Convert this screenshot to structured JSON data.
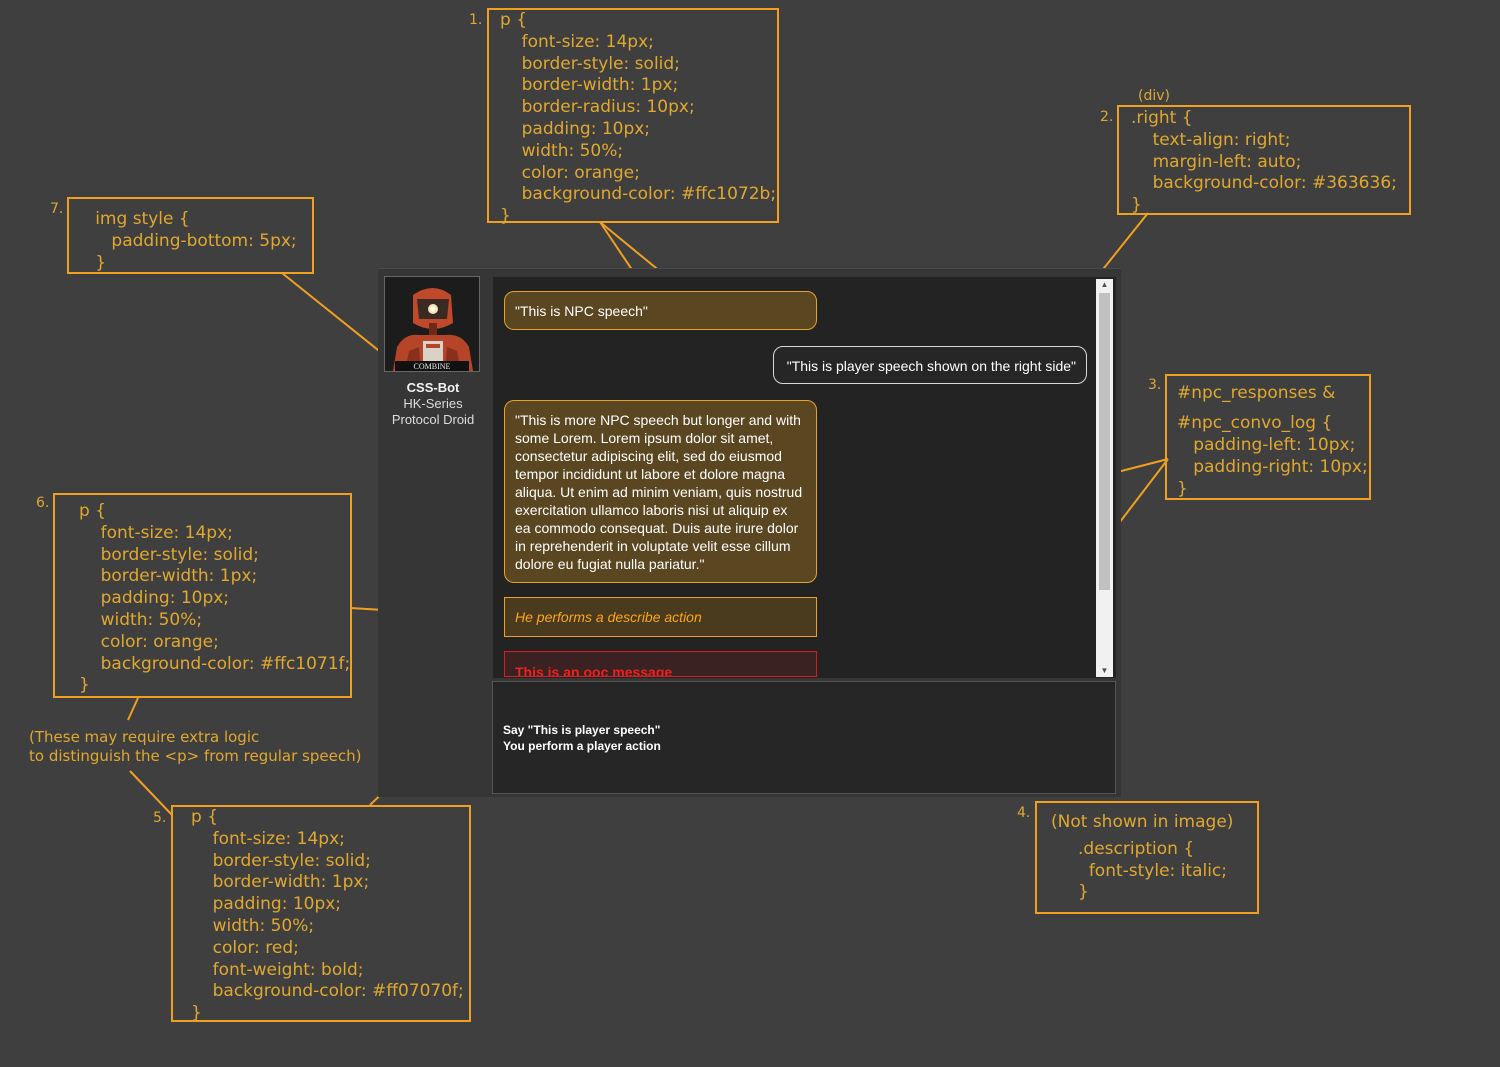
{
  "npc": {
    "portrait_label": "COMBINE",
    "name": "CSS-Bot",
    "line2": "HK-Series",
    "line3": "Protocol Droid"
  },
  "messages": {
    "npc1": "\"This is NPC speech\"",
    "player": "\"This is player speech shown on the right side\"",
    "npc2": "\"This is more NPC speech but longer and with some Lorem. Lorem ipsum dolor sit amet, consectetur adipiscing elit, sed do eiusmod tempor incididunt ut labore et dolore magna aliqua. Ut enim ad minim veniam, quis nostrud exercitation ullamco laboris nisi ut aliquip ex ea commodo consequat. Duis aute irure dolor in reprehenderit in voluptate velit esse cillum dolore eu fugiat nulla pariatur.\"",
    "describe": "He performs a describe action",
    "ooc": "This is an ooc message"
  },
  "responses": [
    "Say \"This is player speech\"",
    "You perform a player action"
  ],
  "annotations": {
    "a1": {
      "number": "1.",
      "lines": [
        "p {",
        "    font-size: 14px;",
        "    border-style: solid;",
        "    border-width: 1px;",
        "    border-radius: 10px;",
        "    padding: 10px;",
        "    width: 50%;",
        "    color: orange;",
        "    background-color: #ffc1072b;",
        "}"
      ]
    },
    "a2": {
      "number": "2.",
      "caption": "(div)",
      "lines": [
        ".right {",
        "    text-align: right;",
        "    margin-left: auto;",
        "    background-color: #363636;",
        "}"
      ]
    },
    "a3": {
      "number": "3.",
      "lines": [
        "#npc_responses &",
        "",
        "#npc_convo_log {",
        "   padding-left: 10px;",
        "   padding-right: 10px;",
        "}"
      ]
    },
    "a4": {
      "number": "4.",
      "lines": [
        "(Not shown in image)",
        "",
        "     .description {",
        "       font-style: italic;",
        "     }"
      ]
    },
    "a5": {
      "number": "5.",
      "lines": [
        "p {",
        "    font-size: 14px;",
        "    border-style: solid;",
        "    border-width: 1px;",
        "    padding: 10px;",
        "    width: 50%;",
        "    color: red;",
        "    font-weight: bold;",
        "    background-color: #ff07070f;",
        "}"
      ]
    },
    "a6": {
      "number": "6.",
      "lines": [
        "p {",
        "    font-size: 14px;",
        "    border-style: solid;",
        "    border-width: 1px;",
        "    padding: 10px;",
        "    width: 50%;",
        "    color: orange;",
        "    background-color: #ffc1071f;",
        "}"
      ],
      "note": "(These may require extra logic\nto distinguish the <p> from regular speech)"
    },
    "a7": {
      "number": "7.",
      "lines": [
        "   img style {",
        "      padding-bottom: 5px;",
        "   }"
      ]
    }
  },
  "colors": {
    "accent": "#f0a020",
    "background": "#3f3f3f"
  }
}
